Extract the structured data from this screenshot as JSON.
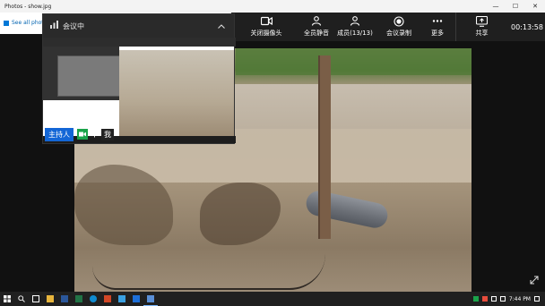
{
  "window": {
    "title": "Photos - show.jpg",
    "minimize": "—",
    "maximize": "☐",
    "close": "✕"
  },
  "photos": {
    "see_all": "See all photos"
  },
  "meeting_toolbar": {
    "camera_off": "关闭摄像头",
    "mute_all": "全员静音",
    "members": "成员(13/13)",
    "record": "会议录制",
    "more": "更多",
    "share": "共享",
    "timer": "00:13:58",
    "icons": {
      "camera": "video-camera-icon",
      "mute": "mute-all-icon",
      "members": "people-icon",
      "record": "record-icon",
      "more": "more-icon",
      "share": "share-screen-icon"
    }
  },
  "mini_window": {
    "title": "会议中",
    "host_badge": "主持人",
    "me_label": "我"
  },
  "taskbar": {
    "clock": "7:44 PM"
  },
  "colors": {
    "accent_blue": "#1366d6",
    "cam_green": "#1aa34a",
    "toolbar_bg": "#1f1f1f"
  }
}
